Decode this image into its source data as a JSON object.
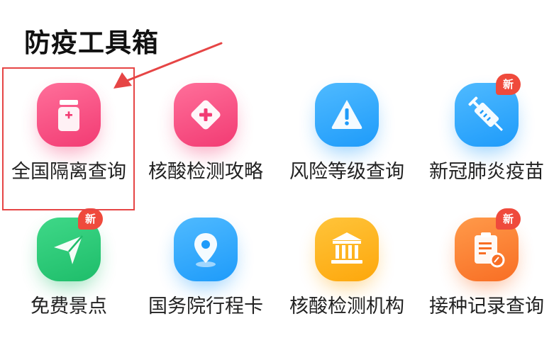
{
  "page": {
    "title": "防疫工具箱"
  },
  "colors": {
    "highlight": "#e64545",
    "badge": "#ef4a3c",
    "pink": "#f23b73",
    "blue": "#1e9bfa",
    "green": "#1ebd6a",
    "yellow": "#fda70c",
    "orange": "#f86e24"
  },
  "tools": [
    {
      "label": "全国隔离查询",
      "icon": "medicine-bottle-icon",
      "color": "pink",
      "badge": ""
    },
    {
      "label": "核酸检测攻略",
      "icon": "diamond-plus-icon",
      "color": "pink",
      "badge": ""
    },
    {
      "label": "风险等级查询",
      "icon": "warning-triangle-icon",
      "color": "blue",
      "badge": ""
    },
    {
      "label": "新冠肺炎疫苗",
      "icon": "syringe-icon",
      "color": "blue",
      "badge": "新"
    },
    {
      "label": "免费景点",
      "icon": "send-arrow-icon",
      "color": "green",
      "badge": "新"
    },
    {
      "label": "国务院行程卡",
      "icon": "location-pin-icon",
      "color": "blue",
      "badge": ""
    },
    {
      "label": "核酸检测机构",
      "icon": "institution-building-icon",
      "color": "yellow",
      "badge": ""
    },
    {
      "label": "接种记录查询",
      "icon": "clipboard-record-icon",
      "color": "orange",
      "badge": "新"
    }
  ]
}
